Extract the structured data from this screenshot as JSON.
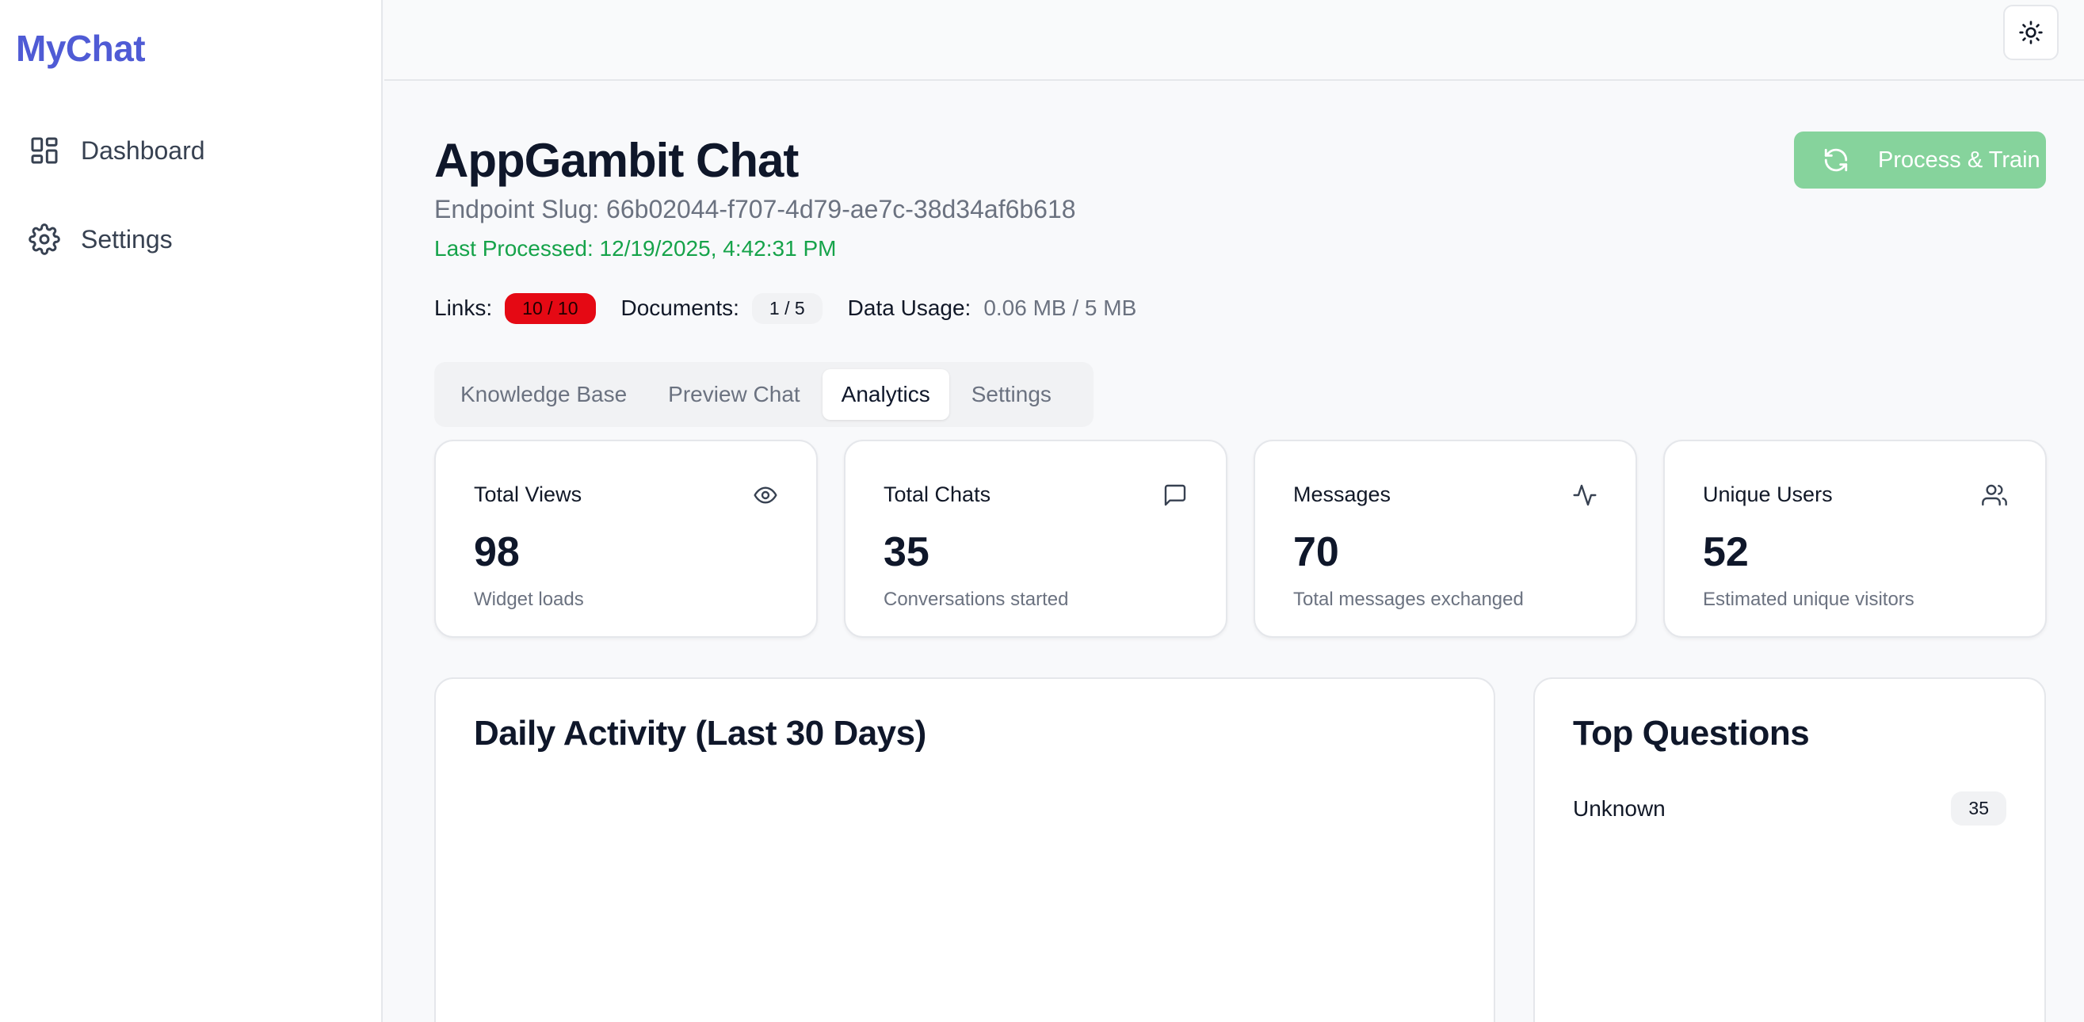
{
  "sidebar": {
    "brand": "MyChat",
    "items": [
      {
        "label": "Dashboard",
        "icon": "dashboard-icon"
      },
      {
        "label": "Settings",
        "icon": "gear-icon"
      }
    ]
  },
  "topbar": {
    "theme_toggle_icon": "sun-icon"
  },
  "header": {
    "title": "AppGambit Chat",
    "slug": "Endpoint Slug: 66b02044-f707-4d79-ae7c-38d34af6b618",
    "last_processed": "Last Processed: 12/19/2025, 4:42:31 PM",
    "process_button": "Process & Train"
  },
  "usage": {
    "links_label": "Links:",
    "links_value": "10 / 10",
    "documents_label": "Documents:",
    "documents_value": "1 / 5",
    "data_label": "Data Usage:",
    "data_value": "0.06 MB / 5 MB"
  },
  "tabs": [
    {
      "label": "Knowledge Base",
      "active": false
    },
    {
      "label": "Preview Chat",
      "active": false
    },
    {
      "label": "Analytics",
      "active": true
    },
    {
      "label": "Settings",
      "active": false
    }
  ],
  "stats": [
    {
      "label": "Total Views",
      "value": "98",
      "desc": "Widget loads",
      "icon": "eye-icon"
    },
    {
      "label": "Total Chats",
      "value": "35",
      "desc": "Conversations started",
      "icon": "chat-bubble-icon"
    },
    {
      "label": "Messages",
      "value": "70",
      "desc": "Total messages exchanged",
      "icon": "activity-icon"
    },
    {
      "label": "Unique Users",
      "value": "52",
      "desc": "Estimated unique visitors",
      "icon": "users-icon"
    }
  ],
  "daily_activity": {
    "title": "Daily Activity (Last 30 Days)"
  },
  "top_questions": {
    "title": "Top Questions",
    "items": [
      {
        "question": "Unknown",
        "count": "35"
      }
    ]
  },
  "colors": {
    "brand": "#4f5bd5",
    "success": "#16a34a",
    "process_button": "#86d39c",
    "links_badge": "#e50914"
  }
}
